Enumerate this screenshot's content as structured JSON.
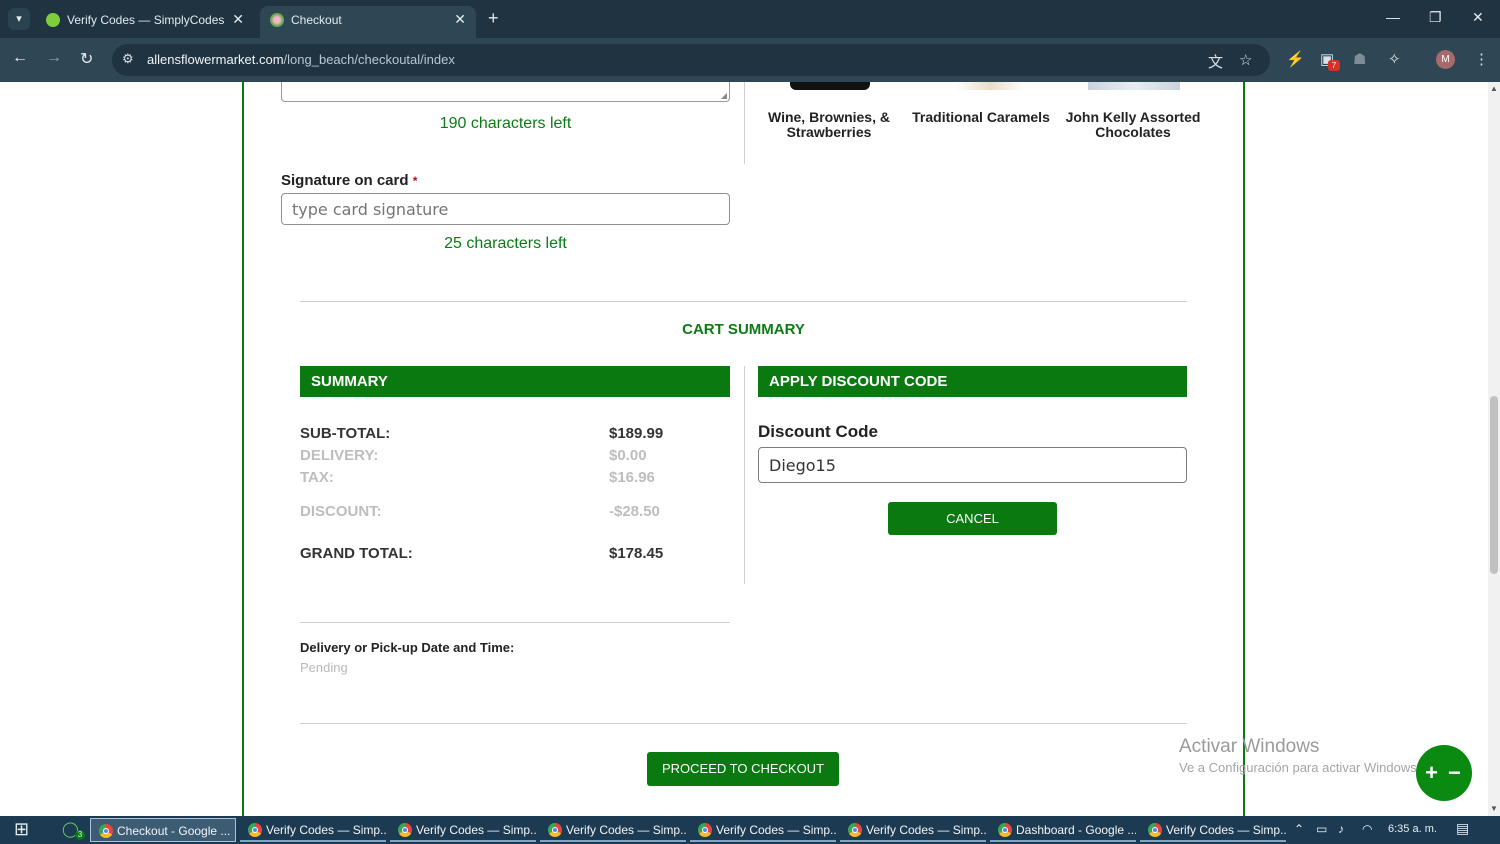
{
  "browser": {
    "tabs": [
      {
        "title": "Verify Codes — SimplyCodes",
        "active": false
      },
      {
        "title": "Checkout",
        "active": true
      }
    ],
    "url_domain": "allensflowermarket.com",
    "url_path": "/long_beach/checkoutal/index",
    "extension_badge": "7",
    "profile_initial": "M"
  },
  "message": {
    "chars_left": "190 characters left"
  },
  "products": [
    {
      "name": "Wine, Brownies, & Strawberries"
    },
    {
      "name": "Traditional Caramels"
    },
    {
      "name": "John Kelly Assorted Chocolates"
    }
  ],
  "signature": {
    "label": "Signature on card",
    "required_mark": "*",
    "placeholder": "type card signature",
    "chars_left": "25 characters left"
  },
  "cart": {
    "title": "CART SUMMARY",
    "summary_header": "SUMMARY",
    "rows": [
      {
        "label": "SUB-TOTAL:",
        "value": "$189.99"
      },
      {
        "label": "DELIVERY:",
        "value": "$0.00"
      },
      {
        "label": "TAX:",
        "value": "$16.96"
      },
      {
        "label": "DISCOUNT:",
        "value": "-$28.50"
      },
      {
        "label": "GRAND TOTAL:",
        "value": "$178.45"
      }
    ],
    "discount_header": "APPLY DISCOUNT CODE",
    "discount_label": "Discount Code",
    "discount_value": "Diego15",
    "cancel_label": "CANCEL",
    "delivery_label": "Delivery or Pick-up Date and Time:",
    "delivery_value": "Pending",
    "checkout_label": "PROCEED TO CHECKOUT"
  },
  "watermark": {
    "line1": "Activar Windows",
    "line2": "Ve a Configuración para activar Windows."
  },
  "fab": {
    "label": "+ −"
  },
  "taskbar": {
    "items": [
      {
        "label": "Checkout - Google ..."
      },
      {
        "label": "Verify Codes — Simp..."
      },
      {
        "label": "Verify Codes — Simp..."
      },
      {
        "label": "Verify Codes — Simp..."
      },
      {
        "label": "Verify Codes — Simp..."
      },
      {
        "label": "Verify Codes — Simp..."
      },
      {
        "label": "Dashboard - Google ..."
      },
      {
        "label": "Verify Codes — Simp..."
      }
    ],
    "whatsapp_badge": "3",
    "clock": "6:35 a. m."
  },
  "colors": {
    "brand_green": "#0a7a10",
    "chrome_dark": "#1f3340",
    "chrome_toolbar": "#2f4754",
    "taskbar": "#1c3b52"
  }
}
